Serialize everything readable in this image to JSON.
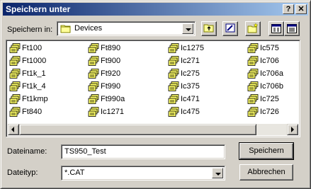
{
  "window": {
    "title": "Speichern unter"
  },
  "titlebar_buttons": {
    "help": "?",
    "close": "✕"
  },
  "location": {
    "label": "Speichern in:",
    "value": "Devices"
  },
  "files": [
    "Ft100",
    "Ft890",
    "Ic1275",
    "Ic575",
    "Ft1000",
    "Ft900",
    "Ic271",
    "Ic706",
    "Ft1k_1",
    "Ft920",
    "Ic275",
    "Ic706a",
    "Ft1k_4",
    "Ft990",
    "Ic375",
    "Ic706b",
    "Ft1kmp",
    "Ft990a",
    "Ic471",
    "Ic725",
    "Ft840",
    "Ic1271",
    "Ic475",
    "Ic726"
  ],
  "filename": {
    "label": "Dateiname:",
    "value": "TS950_Test"
  },
  "filetype": {
    "label": "Dateityp:",
    "value": "*.CAT"
  },
  "buttons": {
    "save": "Speichern",
    "cancel": "Abbrechen"
  }
}
